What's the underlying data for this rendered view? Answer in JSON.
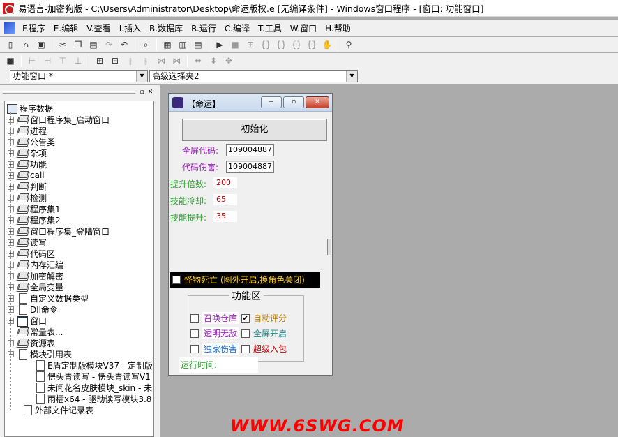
{
  "window_title": "易语言-加密狗版 - C:\\Users\\Administrator\\Desktop\\命运版权.e [无编译条件] - Windows窗口程序 - [窗口: 功能窗口]",
  "menu": [
    "F.程序",
    "E.编辑",
    "V.查看",
    "I.插入",
    "B.数据库",
    "R.运行",
    "C.编译",
    "T.工具",
    "W.窗口",
    "H.帮助"
  ],
  "combos": {
    "window_select": "功能窗口 *",
    "component_select": "高级选择夹2"
  },
  "tree": {
    "root": "程序数据",
    "items": [
      "窗口程序集_启动窗口",
      "进程",
      "公告类",
      "杂项",
      "功能",
      "call",
      "判断",
      "检测",
      "程序集1",
      "程序集2",
      "窗口程序集_登陆窗口",
      "读写",
      "代码区",
      "内存汇编",
      "加密解密",
      "全局变量",
      "自定义数据类型",
      "Dll命令",
      "窗口",
      "常量表...",
      "资源表",
      "模块引用表"
    ],
    "modules": [
      "E盾定制版模块V37 - 定制版",
      "愣头青读写 - 愣头青读写V1",
      "未闻花名皮肤模块_skin - 未",
      "雨檑x64 - 驱动读写模块3.8"
    ],
    "tail": "外部文件记录表"
  },
  "form": {
    "title": "【命运】",
    "init_button": "初始化",
    "fullscreen_code_label": "全屏代码:",
    "fullscreen_code_value": "109004887",
    "damage_code_label": "代码伤害:",
    "damage_code_value": "109004887",
    "multiplier_label": "提升倍数:",
    "multiplier_value": "200",
    "cooldown_label": "技能冷却:",
    "cooldown_value": "65",
    "skill_boost_label": "技能提升:",
    "skill_boost_value": "35",
    "monster_death": "怪物死亡 (图外开启,换角色关闭)",
    "group_title": "功能区",
    "options": [
      {
        "label": "召唤仓库",
        "checked": false,
        "color": "#a020c0"
      },
      {
        "label": "自动评分",
        "checked": true,
        "color": "#c08000"
      },
      {
        "label": "透明无敌",
        "checked": false,
        "color": "#a020c0"
      },
      {
        "label": "全屏开启",
        "checked": false,
        "color": "#1a8a8a"
      },
      {
        "label": "独家伤害",
        "checked": false,
        "color": "#1a6ad0"
      },
      {
        "label": "超级入包",
        "checked": false,
        "color": "#c00000"
      }
    ],
    "runtime_label": "运行时间:"
  },
  "watermark": "WWW.6SWG.COM",
  "colors": {
    "green_label": "#2ea12e",
    "purple_label": "#a020c0",
    "value_red": "#c00000",
    "watermark": "#ff0000"
  }
}
